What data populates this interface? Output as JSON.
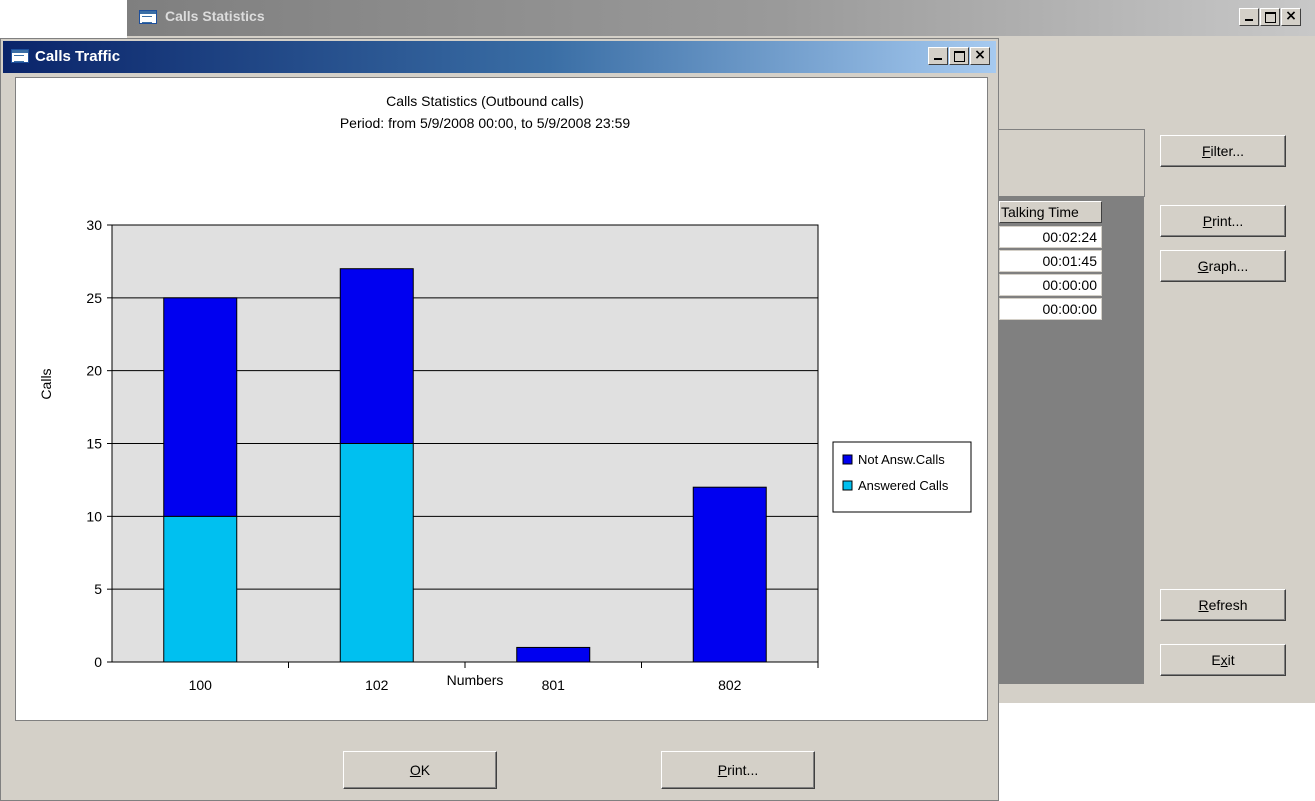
{
  "background_window": {
    "title": "Calls Statistics",
    "grid": {
      "header": "Talking Time",
      "rows": [
        "00:02:24",
        "00:01:45",
        "00:00:00",
        "00:00:00"
      ]
    },
    "buttons": {
      "filter": {
        "mnemonic": "F",
        "rest": "ilter..."
      },
      "print": {
        "mnemonic": "P",
        "rest": "rint..."
      },
      "graph": {
        "mnemonic": "G",
        "rest": "raph..."
      },
      "refresh": {
        "mnemonic": "R",
        "rest": "efresh"
      },
      "exit": {
        "pre": "E",
        "mnemonic": "x",
        "rest": "it"
      }
    }
  },
  "front_window": {
    "title": "Calls Traffic",
    "buttons": {
      "ok": {
        "mnemonic": "O",
        "rest": "K"
      },
      "print": {
        "mnemonic": "P",
        "rest": "rint..."
      }
    }
  },
  "window_controls": {
    "close_glyph": "×"
  },
  "colors": {
    "not_answered": "#0000f0",
    "answered": "#00c0f0",
    "plot_bg": "#e0e0e0"
  },
  "chart_data": {
    "type": "bar",
    "stacked": true,
    "title": "Calls Statistics (Outbound calls)",
    "subtitle": "Period: from 5/9/2008 00:00, to 5/9/2008 23:59",
    "xlabel": "Numbers",
    "ylabel": "Calls",
    "categories": [
      "100",
      "102",
      "801",
      "802"
    ],
    "series": [
      {
        "name": "Answered Calls",
        "values": [
          10,
          15,
          0,
          0
        ]
      },
      {
        "name": "Not Answ.Calls",
        "values": [
          15,
          12,
          1,
          12
        ]
      }
    ],
    "legend_order": [
      "Not Answ.Calls",
      "Answered Calls"
    ],
    "ylim": [
      0,
      30
    ],
    "yticks": [
      0,
      5,
      10,
      15,
      20,
      25,
      30
    ],
    "grid": true,
    "legend_position": "right"
  }
}
